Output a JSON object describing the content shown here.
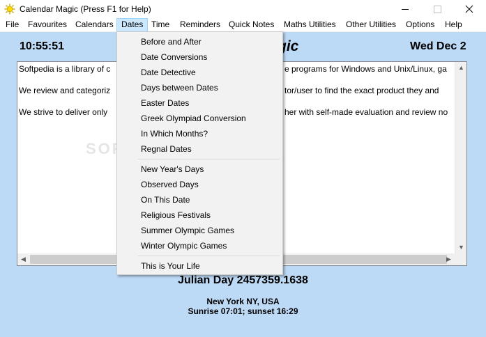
{
  "window": {
    "title": "Calendar Magic (Press F1 for Help)",
    "icon": "sun-icon"
  },
  "menubar": {
    "items": [
      "File",
      "Favourites",
      "Calendars",
      "Dates",
      "Time",
      "Reminders",
      "Quick Notes",
      "Maths Utilities",
      "Other Utilities",
      "Options",
      "Help"
    ],
    "open_item": "Dates"
  },
  "main": {
    "clock": "10:55:51",
    "heading_partial": "gic",
    "date": "Wed Dec 2",
    "text_lines": [
      "Softpedia is a library of c",
      "We review and categoriz",
      "We strive to deliver only"
    ],
    "text_lines_right": [
      "e programs for Windows and Unix/Linux, ga",
      "tor/user to find the exact product they and",
      "her with self-made evaluation and review no"
    ],
    "watermark": "SOFTPEDIA",
    "julian_day": "Julian Day 2457359.1638",
    "location": "New York NY, USA",
    "sun_times": "Sunrise 07:01; sunset 16:29"
  },
  "dates_menu": {
    "group1": [
      "Before and After",
      "Date Conversions",
      "Date Detective",
      "Days between Dates",
      "Easter Dates",
      "Greek Olympiad Conversion",
      "In Which Months?",
      "Regnal Dates"
    ],
    "group2": [
      "New Year's Days",
      "Observed Days",
      "On This Date",
      "Religious Festivals",
      "Summer Olympic Games",
      "Winter Olympic Games"
    ],
    "group3": [
      "This is Your Life"
    ]
  },
  "colors": {
    "content_bg": "#bcd9f5",
    "menu_highlight": "#cce8ff",
    "dropdown_bg": "#f2f2f2"
  }
}
